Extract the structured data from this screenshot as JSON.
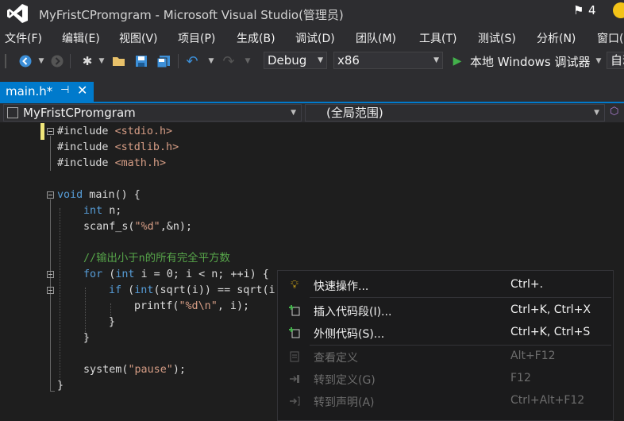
{
  "window": {
    "title": "MyFristCPromgram - Microsoft Visual Studio(管理员)",
    "notification_count": "4",
    "icons": [
      "vs-logo-icon",
      "flag-icon",
      "smiley-icon"
    ]
  },
  "menu": [
    "文件(F)",
    "编辑(E)",
    "视图(V)",
    "项目(P)",
    "生成(B)",
    "调试(D)",
    "团队(M)",
    "工具(T)",
    "测试(S)",
    "分析(N)",
    "窗口("
  ],
  "toolbar": {
    "config": "Debug",
    "platform": "x86",
    "run_label": "本地 Windows 调试器",
    "extra_combo": "自动"
  },
  "tab": {
    "label": "main.h*",
    "pin": "⊣",
    "close": "✕"
  },
  "nav": {
    "project": "MyFristCPromgram",
    "scope": "(全局范围)"
  },
  "code": {
    "l1a": "#include ",
    "l1b": "<stdio.h>",
    "l2a": "#include ",
    "l2b": "<stdlib.h>",
    "l3a": "#include ",
    "l3b": "<math.h>",
    "l5a": "void",
    "l5b": " main() {",
    "l6a": "int",
    "l6b": " n;",
    "l7a": "scanf_s(",
    "l7b": "\"%d\"",
    "l7c": ",&n);",
    "l9": "//输出小于n的所有完全平方数",
    "l10a": "for",
    "l10b": " (",
    "l10c": "int",
    "l10d": " i = 0; i < n; ++i) {",
    "l11a": "if",
    "l11b": " (",
    "l11c": "int",
    "l11d": "(sqrt(i)) == sqrt(i)",
    "l12a": "printf(",
    "l12b": "\"%d\\n\"",
    "l12c": ", i);",
    "l13": "}",
    "l14": "}",
    "l16a": "system(",
    "l16b": "\"pause\"",
    "l16c": ");",
    "l17": "}"
  },
  "context_menu": [
    {
      "label": "快速操作...",
      "shortcut": "Ctrl+.",
      "enabled": true,
      "icon": "lightbulb-icon"
    },
    {
      "label": "插入代码段(I)...",
      "shortcut": "Ctrl+K, Ctrl+X",
      "enabled": true,
      "icon": "insert-snippet-icon"
    },
    {
      "label": "外侧代码(S)...",
      "shortcut": "Ctrl+K, Ctrl+S",
      "enabled": true,
      "icon": "surround-with-icon"
    },
    {
      "label": "查看定义",
      "shortcut": "Alt+F12",
      "enabled": false,
      "icon": "peek-definition-icon"
    },
    {
      "label": "转到定义(G)",
      "shortcut": "F12",
      "enabled": false,
      "icon": "go-to-definition-icon"
    },
    {
      "label": "转到声明(A)",
      "shortcut": "Ctrl+Alt+F12",
      "enabled": false,
      "icon": "go-to-declaration-icon"
    }
  ],
  "colors": {
    "accent": "#007acc",
    "chrome": "#2d2d30",
    "editor_bg": "#1e1e1e",
    "keyword": "#569cd6",
    "string": "#d69d85",
    "comment": "#57a64a"
  }
}
